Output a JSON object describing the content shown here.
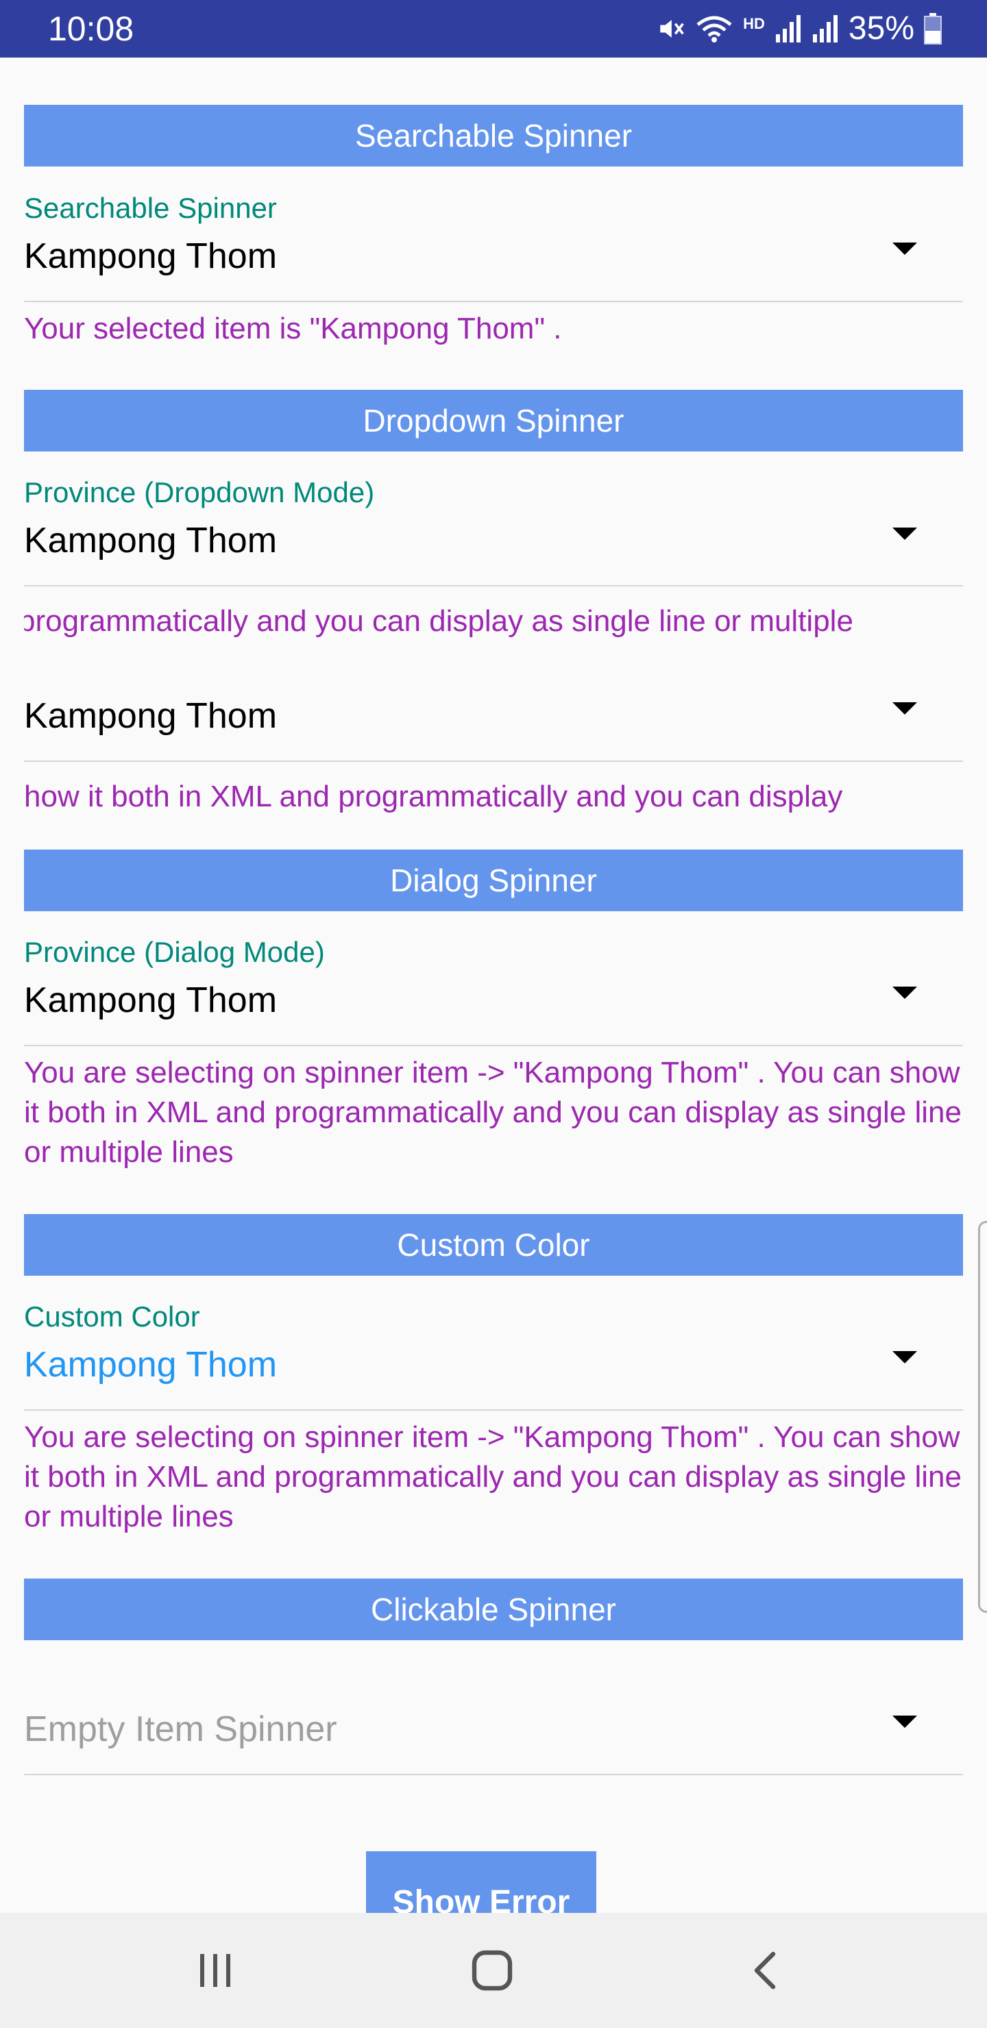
{
  "status_bar": {
    "time": "10:08",
    "battery_percent": "35%",
    "network_label": "HD",
    "icons": [
      "mute-icon",
      "wifi-icon",
      "signal-icon",
      "signal-icon",
      "battery-icon"
    ]
  },
  "sections": {
    "searchable": {
      "header": "Searchable Spinner",
      "label": "Searchable Spinner",
      "value": "Kampong Thom",
      "message": "Your selected item is \"Kampong Thom\" ."
    },
    "dropdown": {
      "header": "Dropdown Spinner",
      "label": "Province (Dropdown Mode)",
      "value": "Kampong Thom",
      "marquee_message": "programmatically and you can display as single line or multiple",
      "value2": "Kampong Thom",
      "marquee_message2": "how it both in XML and programmatically and you can display"
    },
    "dialog": {
      "header": "Dialog Spinner",
      "label": "Province (Dialog Mode)",
      "value": "Kampong Thom",
      "message": "You are selecting on spinner item -> \"Kampong Thom\" . You can show it both in XML and programmatically and you can display as single line or multiple lines"
    },
    "custom_color": {
      "header": "Custom Color",
      "label": "Custom Color",
      "value": "Kampong Thom",
      "message": "You are selecting on spinner item -> \"Kampong Thom\" . You can show it both in XML and programmatically and you can display as single line or multiple lines"
    },
    "clickable": {
      "header": "Clickable Spinner",
      "hint": "Empty Item Spinner",
      "button": "Show Error"
    }
  },
  "colors": {
    "status_bar": "#303f9f",
    "header_bg": "#6495ed",
    "label": "#00897b",
    "message": "#9c27b0",
    "custom_value": "#2196f3"
  },
  "nav_bar": {
    "icons": [
      "recent-apps-icon",
      "home-icon",
      "back-icon"
    ]
  }
}
